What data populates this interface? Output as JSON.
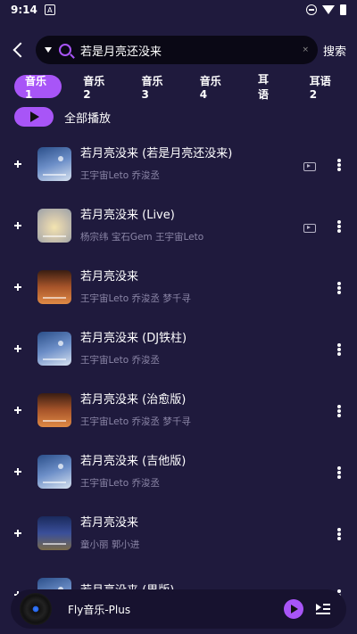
{
  "status_bar": {
    "time": "9:14",
    "notification_icon": "A"
  },
  "header": {
    "back_icon": "chevron-left",
    "search": {
      "value": "若是月亮还没来",
      "placeholder": ""
    },
    "search_action_label": "搜索"
  },
  "tabs": [
    {
      "label": "音乐1",
      "active": true
    },
    {
      "label": "音乐2",
      "active": false
    },
    {
      "label": "音乐3",
      "active": false
    },
    {
      "label": "音乐4",
      "active": false
    },
    {
      "label": "耳语",
      "active": false
    },
    {
      "label": "耳语2",
      "active": false
    }
  ],
  "play_all": {
    "label": "全部播放"
  },
  "songs": [
    {
      "title": "若月亮没来 (若是月亮还没来)",
      "artist": "王宇宙Leto 乔浚丞",
      "has_mv": true
    },
    {
      "title": "若月亮没来 (Live)",
      "artist": "杨宗纬 宝石Gem 王宇宙Leto",
      "has_mv": true
    },
    {
      "title": "若月亮没来",
      "artist": "王宇宙Leto 乔浚丞 梦千寻",
      "has_mv": false
    },
    {
      "title": "若月亮没来 (DJ铁柱)",
      "artist": "王宇宙Leto 乔浚丞",
      "has_mv": false
    },
    {
      "title": "若月亮没来 (治愈版)",
      "artist": "王宇宙Leto 乔浚丞 梦千寻",
      "has_mv": false
    },
    {
      "title": "若月亮没来 (吉他版)",
      "artist": "王宇宙Leto 乔浚丞",
      "has_mv": false
    },
    {
      "title": "若月亮没来",
      "artist": "童小丽 郭小进",
      "has_mv": false
    },
    {
      "title": "若月亮没来 (男版)",
      "artist": "",
      "has_mv": false
    }
  ],
  "player": {
    "title": "Fly音乐-Plus"
  },
  "colors": {
    "background": "#1f1a3d",
    "accent": "#a855f7",
    "secondary_text": "#8c87a8"
  }
}
